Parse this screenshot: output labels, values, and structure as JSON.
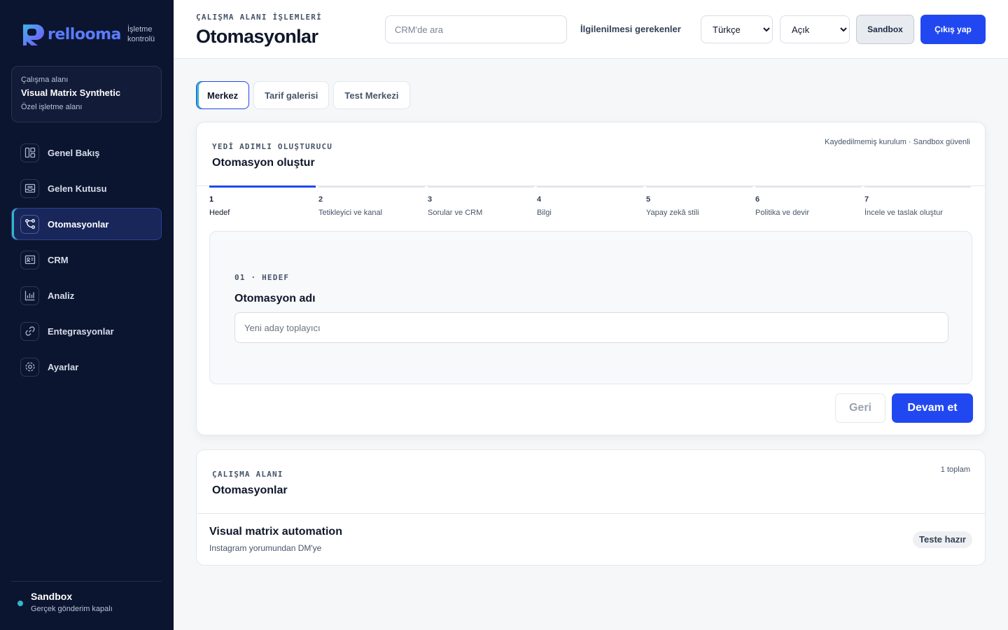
{
  "brand": {
    "name": "rellooma",
    "subtitle_line1": "İşletme",
    "subtitle_line2": "kontrolü",
    "logo_color": "#5b7cff"
  },
  "workspace": {
    "label": "Çalışma alanı",
    "name": "Visual Matrix Synthetic",
    "type": "Özel işletme alanı"
  },
  "nav": [
    {
      "label": "Genel Bakış",
      "icon": "layout-icon",
      "active": false
    },
    {
      "label": "Gelen Kutusu",
      "icon": "inbox-icon",
      "active": false
    },
    {
      "label": "Otomasyonlar",
      "icon": "workflow-icon",
      "active": true
    },
    {
      "label": "CRM",
      "icon": "contact-card-icon",
      "active": false
    },
    {
      "label": "Analiz",
      "icon": "bar-chart-icon",
      "active": false
    },
    {
      "label": "Entegrasyonlar",
      "icon": "link-icon",
      "active": false
    },
    {
      "label": "Ayarlar",
      "icon": "gear-icon",
      "active": false
    }
  ],
  "sandbox_status": {
    "title": "Sandbox",
    "subtitle": "Gerçek gönderim kapalı",
    "dot_color": "#2fb8c9"
  },
  "header": {
    "kicker": "ÇALIŞMA ALANI İŞLEMLERİ",
    "title": "Otomasyonlar",
    "search_placeholder": "CRM'de ara",
    "attention_label": "İlgilenilmesi gerekenler",
    "language_value": "Türkçe",
    "theme_value": "Açık",
    "sandbox_button": "Sandbox",
    "logout_button": "Çıkış yap"
  },
  "tabs": [
    {
      "label": "Merkez",
      "active": true
    },
    {
      "label": "Tarif galerisi",
      "active": false
    },
    {
      "label": "Test Merkezi",
      "active": false
    }
  ],
  "builder": {
    "kicker": "YEDİ ADIMLI OLUŞTURUCU",
    "title": "Otomasyon oluştur",
    "meta": "Kaydedilmemiş kurulum · Sandbox güvenli",
    "steps": [
      {
        "number": "1",
        "label": "Hedef",
        "active": true
      },
      {
        "number": "2",
        "label": "Tetikleyici ve kanal",
        "active": false
      },
      {
        "number": "3",
        "label": "Sorular ve CRM",
        "active": false
      },
      {
        "number": "4",
        "label": "Bilgi",
        "active": false
      },
      {
        "number": "5",
        "label": "Yapay zekâ stili",
        "active": false
      },
      {
        "number": "6",
        "label": "Politika ve devir",
        "active": false
      },
      {
        "number": "7",
        "label": "İncele ve taslak oluştur",
        "active": false
      }
    ],
    "panel_kicker": "01 · HEDEF",
    "field_label": "Otomasyon adı",
    "field_placeholder": "Yeni aday toplayıcı",
    "field_value": "",
    "back_button": "Geri",
    "next_button": "Devam et"
  },
  "automations": {
    "kicker": "ÇALIŞMA ALANI",
    "title": "Otomasyonlar",
    "count": "1 toplam",
    "items": [
      {
        "name": "Visual matrix automation",
        "description": "Instagram yorumundan DM'ye",
        "status": "Teste hazır"
      }
    ]
  },
  "colors": {
    "accent": "#2148f0",
    "sidebar_bg": "#0c1530",
    "active_indicator": "#33b6c9"
  }
}
